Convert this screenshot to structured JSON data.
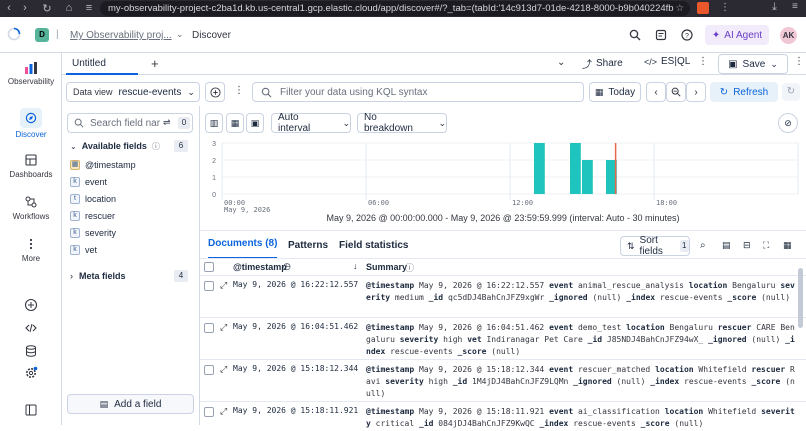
{
  "browser": {
    "url": "my-observability-project-c2ba1d.kb.us-central1.gcp.elastic.cloud/app/discover#/?_tab=(tabId:'14c913d7-01de-4218-8000-b9b040224fb"
  },
  "header": {
    "space_initial": "D",
    "project": "My Observability proj...",
    "page": "Discover",
    "ai_agent": "AI Agent",
    "user_initials": "AK"
  },
  "nav": {
    "observability": "Observability",
    "discover": "Discover",
    "dashboards": "Dashboards",
    "workflows": "Workflows",
    "more": "More"
  },
  "tabs": {
    "active": "Untitled",
    "share": "Share",
    "esql": "ES|QL",
    "save": "Save"
  },
  "query": {
    "data_view_label": "Data view",
    "data_view_value": "rescue-events",
    "kql_placeholder": "Filter your data using KQL syntax",
    "date": "Today",
    "refresh": "Refresh"
  },
  "sidebar": {
    "search_placeholder": "Search field nar",
    "filter_count": "0",
    "available_label": "Available fields",
    "available_count": "6",
    "fields": [
      {
        "type": "cal",
        "name": "@timestamp"
      },
      {
        "type": "k",
        "name": "event"
      },
      {
        "type": "t",
        "name": "location"
      },
      {
        "type": "k",
        "name": "rescuer"
      },
      {
        "type": "k",
        "name": "severity"
      },
      {
        "type": "k",
        "name": "vet"
      }
    ],
    "meta_label": "Meta fields",
    "meta_count": "4",
    "add_field": "Add a field"
  },
  "histogram": {
    "interval": "Auto interval",
    "breakdown": "No breakdown",
    "time_range": "May 9, 2026 @ 00:00:00.000 - May 9, 2026 @ 23:59:59.999 (interval: Auto - 30 minutes)"
  },
  "chart_data": {
    "type": "bar",
    "title": "",
    "xlabel": "",
    "ylabel": "",
    "x_ticks": [
      "00:00",
      "06:00",
      "12:00",
      "18:00"
    ],
    "x_sublabel": "May 9, 2026",
    "y_ticks": [
      "0",
      "1",
      "2",
      "3"
    ],
    "ylim": [
      0,
      3
    ],
    "xlim_hours": [
      0,
      24
    ],
    "bars": [
      {
        "start": 13.0,
        "value": 3
      },
      {
        "start": 14.5,
        "value": 3
      },
      {
        "start": 15.0,
        "value": 2
      },
      {
        "start": 16.0,
        "value": 2
      }
    ],
    "now_marker": 16.4,
    "bar_color": "#20c4be",
    "marker_color": "#e7664c"
  },
  "docs": {
    "tab_documents": "Documents (8)",
    "tab_patterns": "Patterns",
    "tab_stats": "Field statistics",
    "sort_fields": "Sort fields",
    "sort_count": "1",
    "col_timestamp": "@timestamp",
    "col_summary": "Summary",
    "rows": [
      {
        "timestamp": "May 9, 2026 @ 16:22:12.557",
        "summary": [
          [
            "@timestamp",
            "May 9, 2026 @ 16:22:12.557"
          ],
          [
            "event",
            "animal_rescue_analysis"
          ],
          [
            "location",
            "Bengaluru"
          ],
          [
            "severity",
            "medium"
          ],
          [
            "_id",
            "qc5dDJ4BahCnJFZ9xgWr"
          ],
          [
            "_ignored",
            "(null)"
          ],
          [
            "_index",
            "rescue-events"
          ],
          [
            "_score",
            "(null)"
          ]
        ]
      },
      {
        "timestamp": "May 9, 2026 @ 16:04:51.462",
        "summary": [
          [
            "@timestamp",
            "May 9, 2026 @ 16:04:51.462"
          ],
          [
            "event",
            "demo_test"
          ],
          [
            "location",
            "Bengaluru"
          ],
          [
            "rescuer",
            "CARE Bengaluru"
          ],
          [
            "severity",
            "high"
          ],
          [
            "vet",
            "Indiranagar Pet Care"
          ],
          [
            "_id",
            "J85NDJ4BahCnJFZ94wX_"
          ],
          [
            "_ignored",
            "(null)"
          ],
          [
            "_index",
            "rescue-events"
          ],
          [
            "_score",
            "(null)"
          ]
        ]
      },
      {
        "timestamp": "May 9, 2026 @ 15:18:12.344",
        "summary": [
          [
            "@timestamp",
            "May 9, 2026 @ 15:18:12.344"
          ],
          [
            "event",
            "rescuer_matched"
          ],
          [
            "location",
            "Whitefield"
          ],
          [
            "rescuer",
            "Ravi"
          ],
          [
            "severity",
            "high"
          ],
          [
            "_id",
            "1M4jDJ4BahCnJFZ9LQMn"
          ],
          [
            "_ignored",
            "(null)"
          ],
          [
            "_index",
            "rescue-events"
          ],
          [
            "_score",
            "(null)"
          ]
        ]
      },
      {
        "timestamp": "May 9, 2026 @ 15:18:11.921",
        "summary": [
          [
            "@timestamp",
            "May 9, 2026 @ 15:18:11.921"
          ],
          [
            "event",
            "ai_classification"
          ],
          [
            "location",
            "Whitefield"
          ],
          [
            "severity",
            "critical"
          ],
          [
            "_id",
            "084jDJ4BahCnJFZ9KwQC"
          ],
          [
            "_index",
            "rescue-events"
          ],
          [
            "_score",
            "(null)"
          ]
        ]
      }
    ]
  }
}
